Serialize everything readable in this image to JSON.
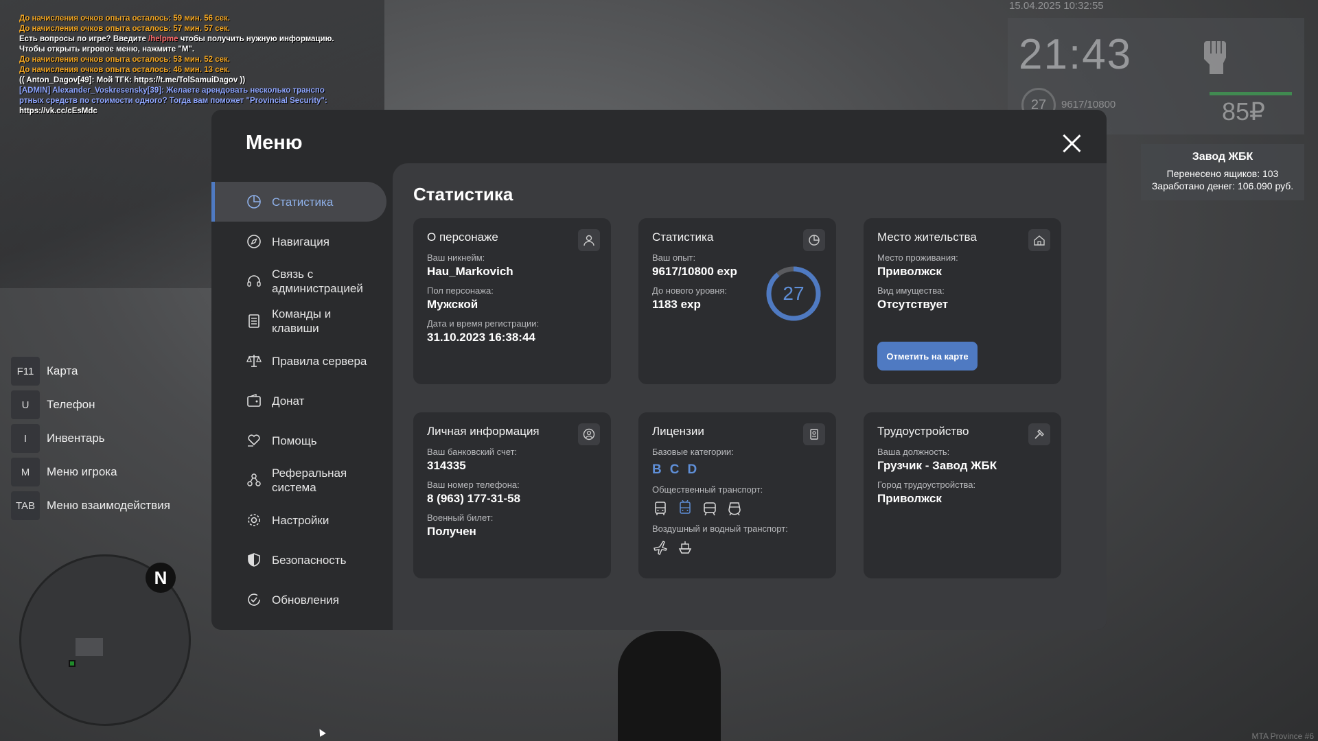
{
  "chat": [
    {
      "text": "До начисления очков опыта осталось: 59 мин. 56 сек.",
      "color": "orange"
    },
    {
      "text": "До начисления очков опыта осталось: 57 мин. 57 сек.",
      "color": "orange"
    },
    {
      "prefix": "Есть вопросы по игре? Введите ",
      "cmd": "/helpme",
      "suffix": " чтобы получить нужную информацию."
    },
    {
      "text": "Чтобы открыть игровое меню, нажмите \"M\".",
      "color": "white"
    },
    {
      "text": "До начисления очков опыта осталось: 53 мин. 52 сек.",
      "color": "orange"
    },
    {
      "text": "До начисления очков опыта осталось: 46 мин. 13 сек.",
      "color": "orange"
    },
    {
      "text": "(( Anton_Dagov[49]: Мой ТГК: https://t.me/TolSamuiDagov ))",
      "color": "white"
    },
    {
      "text": "[ADMIN] Alexander_Voskresensky[39]: Желаете арендовать несколько транспо",
      "color": "blue"
    },
    {
      "text": "ртных средств по стоимости одного? Тогда вам поможет \"Provincial Security\":",
      "color": "blue"
    },
    {
      "text": " https://vk.cc/cEsMdc",
      "color": "blue"
    }
  ],
  "hud": {
    "datetime": "15.04.2025 10:32:55",
    "time": "21:43",
    "level": "27",
    "exp": "9617/10800",
    "money": "85₽"
  },
  "job_panel": {
    "title": "Завод ЖБК",
    "line1": "Перенесено ящиков: 103",
    "line2": "Заработано денег: 106.090 руб."
  },
  "keybinds": [
    {
      "key": "F11",
      "label": "Карта"
    },
    {
      "key": "U",
      "label": "Телефон"
    },
    {
      "key": "I",
      "label": "Инвентарь"
    },
    {
      "key": "M",
      "label": "Меню игрока"
    },
    {
      "key": "TAB",
      "label": "Меню взаимодействия"
    }
  ],
  "minimap": {
    "north": "N"
  },
  "watermark": "MTA Province #6",
  "menu": {
    "title": "Меню",
    "nav": [
      {
        "label": "Статистика",
        "icon": "pie-chart-icon",
        "active": true
      },
      {
        "label": "Навигация",
        "icon": "compass-icon"
      },
      {
        "label": "Связь с\nадминистрацией",
        "icon": "headset-icon"
      },
      {
        "label": "Команды и\nклавиши",
        "icon": "document-icon"
      },
      {
        "label": "Правила сервера",
        "icon": "scales-icon"
      },
      {
        "label": "Донат",
        "icon": "wallet-icon"
      },
      {
        "label": "Помощь",
        "icon": "heart-hand-icon"
      },
      {
        "label": "Реферальная\nсистема",
        "icon": "referral-icon"
      },
      {
        "label": "Настройки",
        "icon": "gear-icon"
      },
      {
        "label": "Безопасность",
        "icon": "shield-icon"
      },
      {
        "label": "Обновления",
        "icon": "refresh-check-icon"
      }
    ]
  },
  "stats": {
    "title": "Статистика",
    "character": {
      "title": "О персонаже",
      "nickname_label": "Ваш никнейм:",
      "nickname": "Hau_Markovich",
      "gender_label": "Пол персонажа:",
      "gender": "Мужской",
      "reg_label": "Дата и время регистрации:",
      "reg": "31.10.2023 16:38:44"
    },
    "statistic": {
      "title": "Статистика",
      "exp_label": "Ваш опыт:",
      "exp": "9617/10800 exp",
      "next_label": "До нового уровня:",
      "next": "1183 exp",
      "level": "27",
      "progress": 0.89
    },
    "residence": {
      "title": "Место жительства",
      "place_label": "Место проживания:",
      "place": "Приволжск",
      "property_label": "Вид имущества:",
      "property": "Отсутствует",
      "button": "Отметить на карте"
    },
    "personal": {
      "title": "Личная информация",
      "bank_label": "Ваш банковский счет:",
      "bank": "314335",
      "phone_label": "Ваш номер телефона:",
      "phone": "8 (963) 177-31-58",
      "military_label": "Военный билет:",
      "military": "Получен"
    },
    "licenses": {
      "title": "Лицензии",
      "base_label": "Базовые категории:",
      "base": [
        "B",
        "C",
        "D"
      ],
      "public_label": "Общественный транспорт:",
      "air_label": "Воздушный и водный транспорт:"
    },
    "employment": {
      "title": "Трудоустройство",
      "position_label": "Ваша должность:",
      "position": "Грузчик - Завод ЖБК",
      "city_label": "Город трудоустройства:",
      "city": "Приволжск"
    }
  },
  "colors": {
    "accent": "#4f7ac2",
    "accent_text": "#5f8fd8",
    "card": "#2c2d30",
    "panel": "#3a3b3e"
  }
}
